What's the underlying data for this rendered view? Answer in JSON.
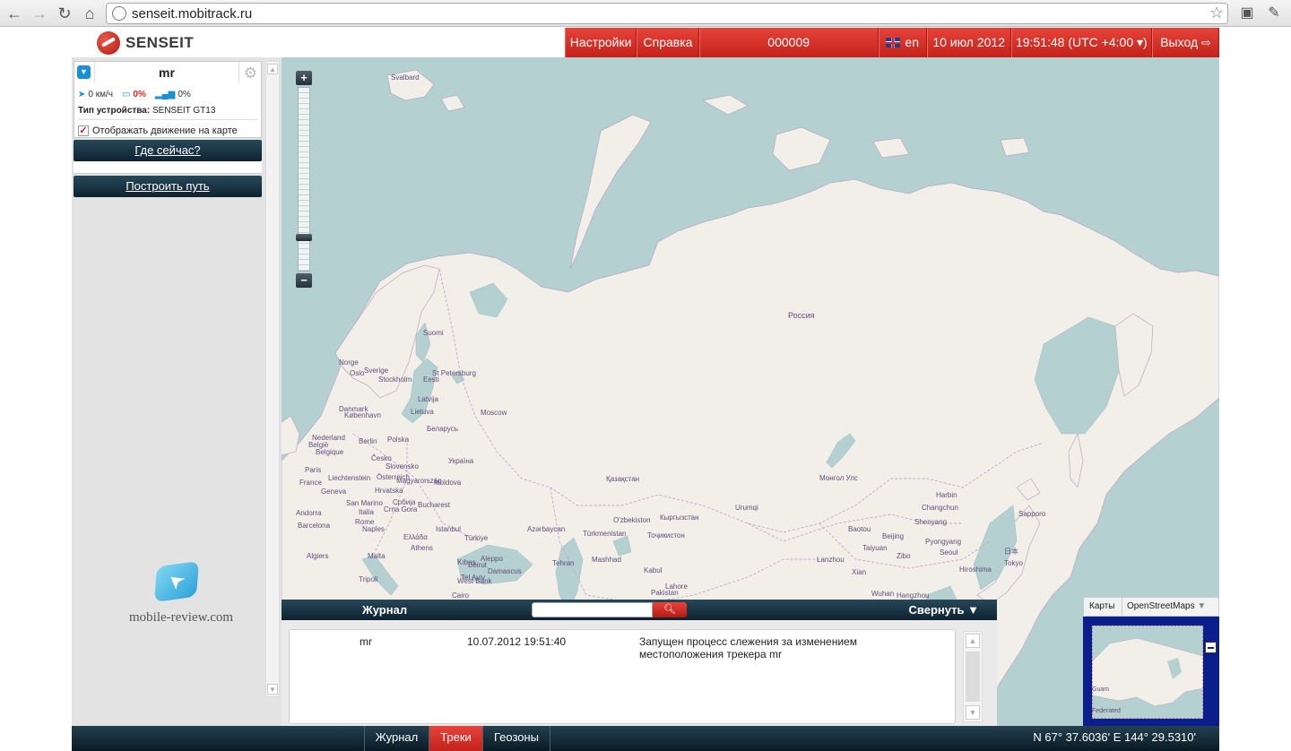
{
  "browser": {
    "url": "senseit.mobitrack.ru"
  },
  "header": {
    "logo_text": "SENSEIT",
    "settings": "Настройки",
    "help": "Справка",
    "device_id": "000009",
    "language": "en",
    "date": "10 июл 2012",
    "time": "19:51:48 (UTC +4:00 ▾)",
    "logout": "Выход"
  },
  "device": {
    "name": "mr",
    "speed": "0 км/ч",
    "battery": "0%",
    "signal": "0%",
    "type_label": "Тип устройства:",
    "type_value": "SENSEIT GT13",
    "show_movement": "Отображать движение на карте",
    "show_movement_checked": true
  },
  "sidebar": {
    "where_now": "Где сейчас?",
    "build_route": "Построить путь",
    "watermark": "mobile-review.com"
  },
  "map": {
    "labels": [
      {
        "text": "Svalbard",
        "big": false
      },
      {
        "text": "Россия",
        "big": false
      },
      {
        "text": "Suomi",
        "big": false
      },
      {
        "text": "Norge",
        "big": false
      },
      {
        "text": "Sverige",
        "big": false
      },
      {
        "text": "Oslo",
        "big": false
      },
      {
        "text": "Stockholm",
        "big": false
      },
      {
        "text": "St Petersburg",
        "big": false
      },
      {
        "text": "Eesti",
        "big": false
      },
      {
        "text": "Latvija",
        "big": false
      },
      {
        "text": "Lietuva",
        "big": false
      },
      {
        "text": "Moscow",
        "big": false
      },
      {
        "text": "Danmark",
        "big": false
      },
      {
        "text": "København",
        "big": false
      },
      {
        "text": "Беларусь",
        "big": false
      },
      {
        "text": "Nederland",
        "big": false
      },
      {
        "text": "Berlin",
        "big": false
      },
      {
        "text": "Polska",
        "big": false
      },
      {
        "text": "België",
        "big": false
      },
      {
        "text": "Belgique",
        "big": false
      },
      {
        "text": "Česko",
        "big": false
      },
      {
        "text": "Україна",
        "big": false
      },
      {
        "text": "Paris",
        "big": false
      },
      {
        "text": "Slovensko",
        "big": false
      },
      {
        "text": "Liechtenstein",
        "big": false
      },
      {
        "text": "Österreich",
        "big": false
      },
      {
        "text": "France",
        "big": false
      },
      {
        "text": "Magyarország",
        "big": false
      },
      {
        "text": "Moldova",
        "big": false
      },
      {
        "text": "Geneva",
        "big": false
      },
      {
        "text": "Hrvatska",
        "big": false
      },
      {
        "text": "San Marino",
        "big": false
      },
      {
        "text": "Србија",
        "big": false
      },
      {
        "text": "Andorra",
        "big": false
      },
      {
        "text": "Italia",
        "big": false
      },
      {
        "text": "Crna Gora",
        "big": false
      },
      {
        "text": "Bucharest",
        "big": false
      },
      {
        "text": "Barcelona",
        "big": false
      },
      {
        "text": "Rome",
        "big": false
      },
      {
        "text": "Naples",
        "big": false
      },
      {
        "text": "Ελλάδα",
        "big": false
      },
      {
        "text": "Istanbul",
        "big": false
      },
      {
        "text": "Türkiye",
        "big": false
      },
      {
        "text": "Azərbaycan",
        "big": false
      },
      {
        "text": "Athens",
        "big": false
      },
      {
        "text": "Algiers",
        "big": false
      },
      {
        "text": "Malta",
        "big": false
      },
      {
        "text": "Tripoli",
        "big": false
      },
      {
        "text": "Kıbrıs",
        "big": false
      },
      {
        "text": "Tehran",
        "big": false
      },
      {
        "text": "Türkmenistan",
        "big": false
      },
      {
        "text": "Mashhad",
        "big": false
      },
      {
        "text": "Қазақстан",
        "big": false
      },
      {
        "text": "O'zbekiston",
        "big": false
      },
      {
        "text": "Кыргызстан",
        "big": false
      },
      {
        "text": "Тоҷикистон",
        "big": false
      },
      {
        "text": "Kabul",
        "big": false
      },
      {
        "text": "Urumqi",
        "big": false
      },
      {
        "text": "Монгол Улс",
        "big": false
      },
      {
        "text": "Harbin",
        "big": false
      },
      {
        "text": "Changchun",
        "big": false
      },
      {
        "text": "Shenyang",
        "big": false
      },
      {
        "text": "Baotou",
        "big": false
      },
      {
        "text": "Beijing",
        "big": false
      },
      {
        "text": "Taiyuan",
        "big": false
      },
      {
        "text": "Pyongyang",
        "big": false
      },
      {
        "text": "Seoul",
        "big": false
      },
      {
        "text": "Sapporo",
        "big": false
      },
      {
        "text": "日本",
        "big": false
      },
      {
        "text": "Tokyo",
        "big": false
      },
      {
        "text": "Hiroshima",
        "big": false
      },
      {
        "text": "Zibo",
        "big": false
      },
      {
        "text": "Lanzhou",
        "big": false
      },
      {
        "text": "Xian",
        "big": false
      },
      {
        "text": "Wuhan",
        "big": false
      },
      {
        "text": "Hangzhou",
        "big": false
      },
      {
        "text": "Cairo",
        "big": false
      },
      {
        "text": "Beirut",
        "big": false
      },
      {
        "text": "Damascus",
        "big": false
      },
      {
        "text": "Pakistan",
        "big": false
      },
      {
        "text": "Lahore",
        "big": false
      },
      {
        "text": "Tel Aviv",
        "big": false
      },
      {
        "text": "West Bank",
        "big": false
      },
      {
        "text": "Aleppo",
        "big": false
      }
    ]
  },
  "journal": {
    "title": "Журнал",
    "collapse": "Свернуть",
    "search_placeholder": "",
    "entries": [
      {
        "device": "mr",
        "time": "10.07.2012 19:51:40",
        "message": "Запущен процесс слежения за изменением местоположения трекера mr"
      }
    ]
  },
  "minimap": {
    "tab_maps": "Карты",
    "tab_source": "OpenStreetMaps",
    "label_guam": "Guam",
    "label_federated": "Federated"
  },
  "bottom": {
    "tabs": [
      "Журнал",
      "Треки",
      "Геозоны"
    ],
    "active_tab": "Треки",
    "coords": "N 67° 37.6036'  E 144° 29.5310'"
  },
  "colors": {
    "accent_red": "#d5322a",
    "dark_bar": "#0e2230",
    "sea": "#b5d0d0",
    "land": "#f2efe9"
  }
}
